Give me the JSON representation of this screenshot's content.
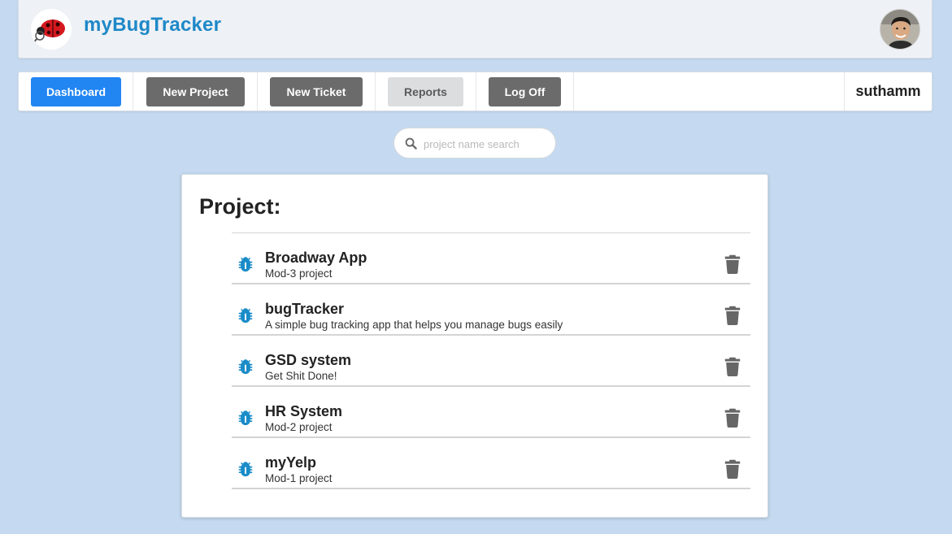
{
  "header": {
    "app_title": "myBugTracker",
    "logo_icon": "ladybug-logo-icon",
    "avatar_icon": "user-avatar"
  },
  "nav": {
    "dashboard_label": "Dashboard",
    "new_project_label": "New Project",
    "new_ticket_label": "New Ticket",
    "reports_label": "Reports",
    "logoff_label": "Log Off",
    "username": "suthamm"
  },
  "search": {
    "placeholder": "project name search",
    "value": "",
    "icon": "search-icon"
  },
  "projects": {
    "heading": "Project:",
    "items": [
      {
        "name": "Broadway App",
        "description": "Mod-3 project"
      },
      {
        "name": "bugTracker",
        "description": "A simple bug tracking app that helps you manage bugs easily"
      },
      {
        "name": "GSD system",
        "description": "Get Shit Done!"
      },
      {
        "name": "HR System",
        "description": "Mod-2 project"
      },
      {
        "name": "myYelp",
        "description": "Mod-1 project"
      }
    ]
  },
  "colors": {
    "page_bg": "#c5daf0",
    "accent": "#1e88c8",
    "primary_button": "#2185f2",
    "dark_button": "#6b6b6b",
    "bug_icon": "#1a8cc8",
    "trash_icon": "#666666"
  }
}
